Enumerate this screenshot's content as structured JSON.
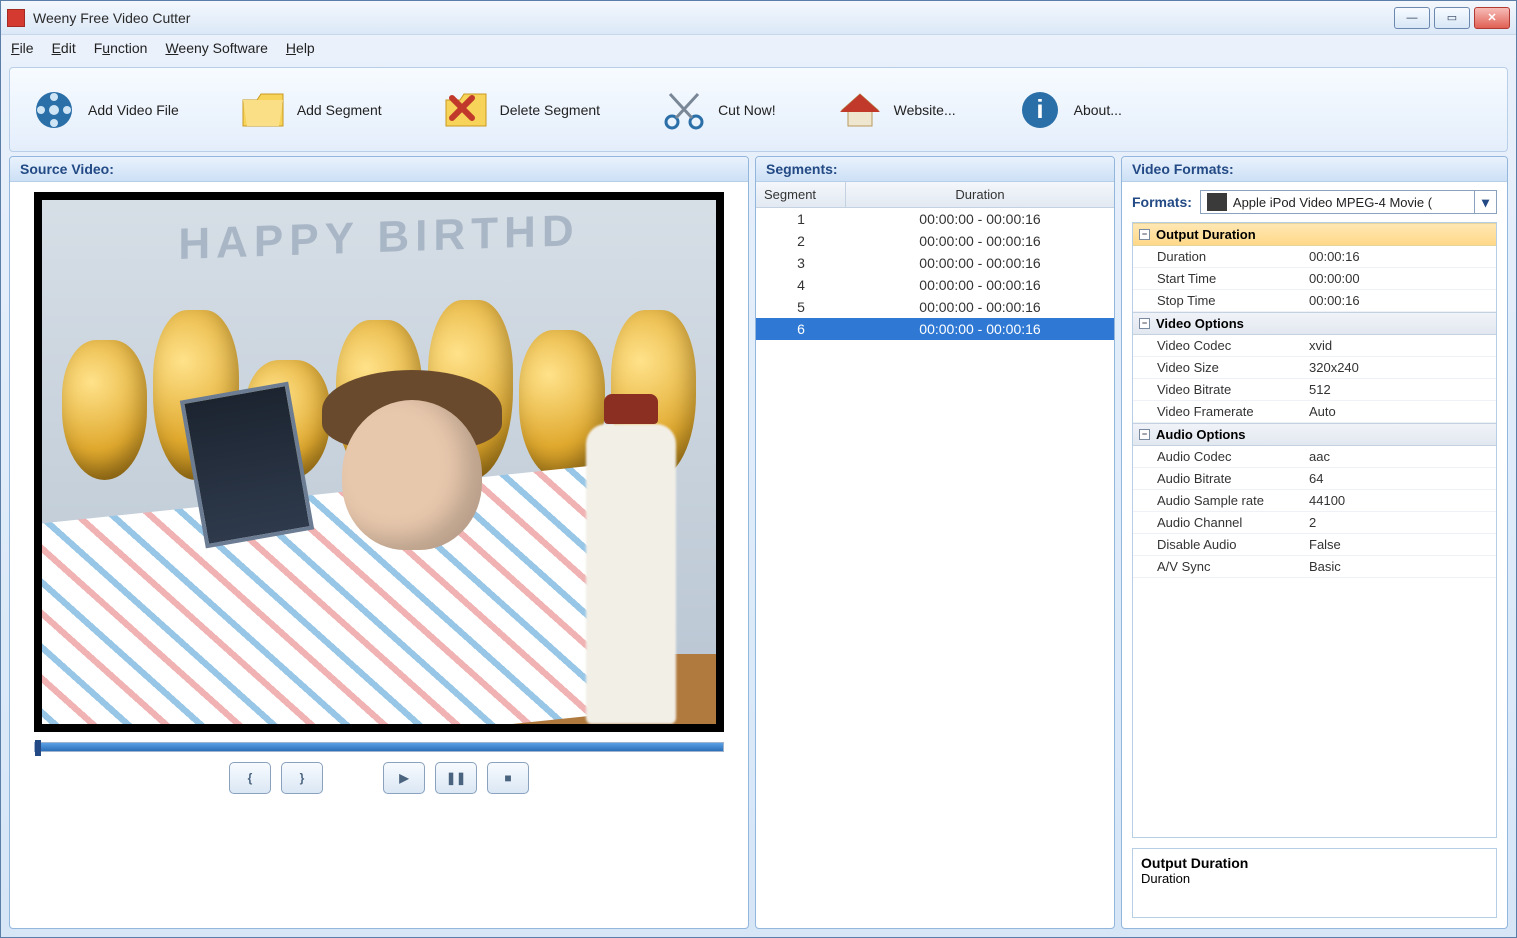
{
  "window": {
    "title": "Weeny Free Video Cutter"
  },
  "menu": {
    "file": "File",
    "edit": "Edit",
    "function": "Function",
    "weeny": "Weeny Software",
    "help": "Help"
  },
  "toolbar": {
    "add_video": "Add Video File",
    "add_segment": "Add Segment",
    "delete_segment": "Delete Segment",
    "cut_now": "Cut Now!",
    "website": "Website...",
    "about": "About..."
  },
  "panels": {
    "source": "Source Video:",
    "segments": "Segments:",
    "formats": "Video Formats:"
  },
  "segments": {
    "col_segment": "Segment",
    "col_duration": "Duration",
    "rows": [
      {
        "id": "1",
        "duration": "00:00:00 - 00:00:16",
        "selected": false
      },
      {
        "id": "2",
        "duration": "00:00:00 - 00:00:16",
        "selected": false
      },
      {
        "id": "3",
        "duration": "00:00:00 - 00:00:16",
        "selected": false
      },
      {
        "id": "4",
        "duration": "00:00:00 - 00:00:16",
        "selected": false
      },
      {
        "id": "5",
        "duration": "00:00:00 - 00:00:16",
        "selected": false
      },
      {
        "id": "6",
        "duration": "00:00:00 - 00:00:16",
        "selected": true
      }
    ]
  },
  "formats": {
    "label": "Formats:",
    "selected": "Apple iPod Video MPEG-4 Movie ("
  },
  "props": {
    "output_duration": {
      "header": "Output Duration",
      "duration_k": "Duration",
      "duration_v": "00:00:16",
      "start_k": "Start Time",
      "start_v": "00:00:00",
      "stop_k": "Stop Time",
      "stop_v": "00:00:16"
    },
    "video_options": {
      "header": "Video Options",
      "codec_k": "Video Codec",
      "codec_v": "xvid",
      "size_k": "Video Size",
      "size_v": "320x240",
      "bitrate_k": "Video Bitrate",
      "bitrate_v": "512",
      "fps_k": "Video Framerate",
      "fps_v": "Auto"
    },
    "audio_options": {
      "header": "Audio Options",
      "codec_k": "Audio Codec",
      "codec_v": "aac",
      "bitrate_k": "Audio Bitrate",
      "bitrate_v": "64",
      "rate_k": "Audio Sample rate",
      "rate_v": "44100",
      "chan_k": "Audio Channel",
      "chan_v": "2",
      "disable_k": "Disable Audio",
      "disable_v": "False",
      "sync_k": "A/V Sync",
      "sync_v": "Basic"
    }
  },
  "description": {
    "title": "Output Duration",
    "detail": "Duration"
  },
  "scene": {
    "banner_text": "HAPPY  BIRTHD"
  }
}
